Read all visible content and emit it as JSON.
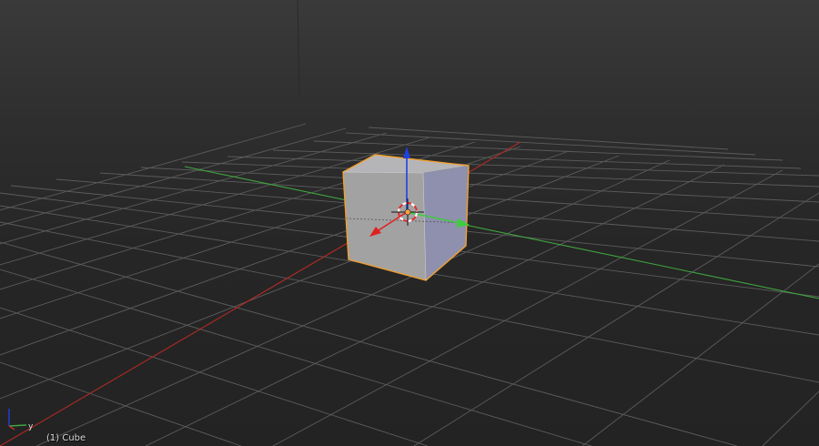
{
  "viewport": {
    "object_info": "(1) Cube",
    "orientation_gizmo": {
      "y_label": "y"
    },
    "selected_object": "Cube",
    "colors": {
      "background": "#2b2b2b",
      "grid": "#5a5a5a",
      "x_axis": "#c0302a",
      "y_axis": "#3fa63f",
      "z_axis": "#2040e0",
      "selection_outline": "#f0a030",
      "cube_face": "#9a9a9a"
    }
  }
}
